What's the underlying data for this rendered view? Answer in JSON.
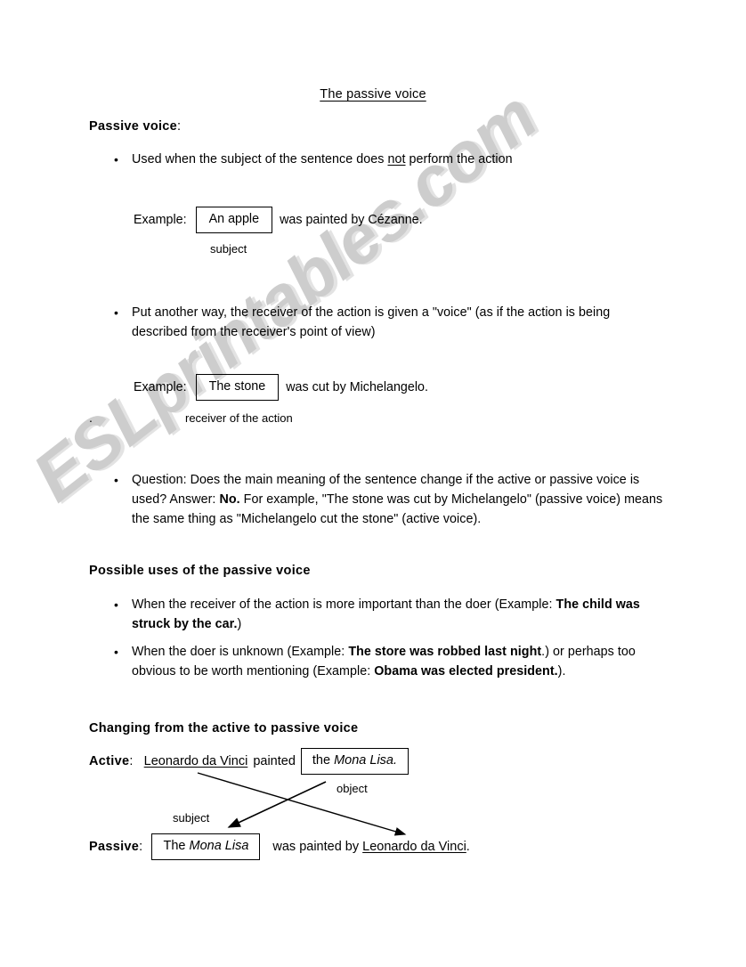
{
  "document": {
    "title": "The passive voice",
    "watermark": "ESLprintables.com",
    "stray_mark": "."
  },
  "section_passive_voice": {
    "heading": "Passive voice",
    "heading_colon": ":",
    "bullets": [
      {
        "before": "Used when the subject of the sentence does ",
        "underlined": "not",
        "after": " perform the action"
      },
      {
        "text": "Put another way, the receiver of the action is given a \"voice\" (as if the action is being described from the receiver's point of view)"
      }
    ],
    "example_1": {
      "label": "Example:",
      "box_text": "An apple",
      "tail_text": "was painted by Cézanne.",
      "caption": "subject"
    },
    "example_2": {
      "label": "Example:",
      "box_text": "The stone",
      "tail_text": "was cut by Michelangelo.",
      "caption": "receiver of the action"
    },
    "question_bullet": {
      "part_1": "Question:  Does the main meaning of the sentence change if the active or passive voice is used?  Answer: ",
      "answer_bold": "No.",
      "part_2": " For example, \"The stone was cut by Michelangelo\" (passive voice) means the same thing as \"Michelangelo cut the stone\" (active voice)."
    }
  },
  "section_possible_uses": {
    "heading": "Possible uses of the passive voice",
    "bullets": [
      {
        "plain_1": "When the receiver of the action is more important than the doer (Example:  ",
        "bold_1": "The child was struck by the car.",
        "plain_2": ")"
      },
      {
        "plain_1": "When the doer is unknown (Example: ",
        "bold_1": "The store was robbed last night",
        "plain_2": ".) or perhaps too obvious to be worth mentioning (Example: ",
        "bold_2": "Obama was elected president.",
        "plain_3": ")."
      }
    ]
  },
  "section_changing": {
    "heading": "Changing from the active to passive voice",
    "active": {
      "label": "Active",
      "label_colon": ":",
      "underlined_subject": "Leonardo da Vinci",
      "verb": "painted",
      "box_prefix": "the ",
      "box_italic": "Mona Lisa.",
      "caption_object": "object"
    },
    "passive": {
      "label": "Passive",
      "label_colon": ":",
      "box_prefix": "The ",
      "box_italic": "Mona Lisa",
      "tail_prefix": "was painted by ",
      "tail_underlined": "Leonardo da Vinci",
      "tail_suffix": ".",
      "caption_subject": "subject"
    }
  }
}
